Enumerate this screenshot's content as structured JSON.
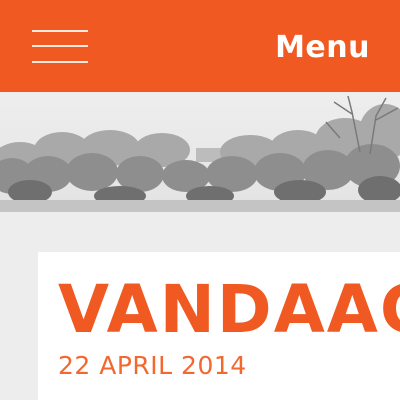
{
  "header": {
    "menu_label": "Menu",
    "menu_icon": "hamburger-icon",
    "background_color": "#f05a22"
  },
  "hero": {
    "image": "black-and-white-tree-line-photo"
  },
  "card": {
    "title": "VANDAAG",
    "date": "22 APRIL 2014",
    "accent_color": "#f05a22"
  }
}
